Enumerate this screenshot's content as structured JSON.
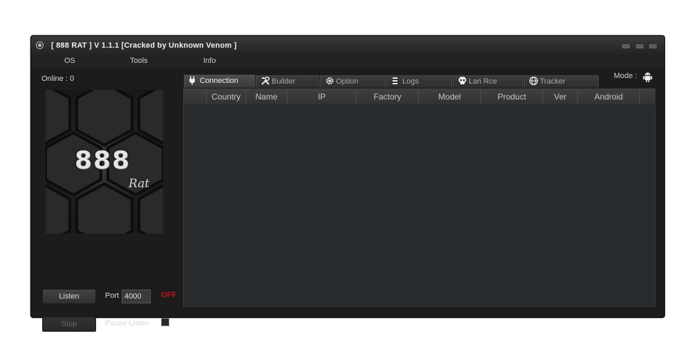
{
  "window": {
    "title": "[  888 RAT  ] V 1.1.1 [Cracked by Unknown Venom ]"
  },
  "menu": [
    "OS",
    "Tools",
    "Info"
  ],
  "status": {
    "online_label": "Online : 0"
  },
  "logo": {
    "main": "888",
    "sub": "Rat"
  },
  "controls": {
    "listen_label": "Listen",
    "stop_label": "Stop",
    "port_label": "Port",
    "port_value": "4000",
    "state_text": "OFF",
    "pause_label": "Pause Listen",
    "pause_checked": false
  },
  "tabs": [
    {
      "label": "Connection",
      "icon": "plug-icon",
      "active": true
    },
    {
      "label": "Builder",
      "icon": "tools-icon",
      "active": false
    },
    {
      "label": "Option",
      "icon": "gear-icon",
      "active": false
    },
    {
      "label": "Logs",
      "icon": "logs-icon",
      "active": false
    },
    {
      "label": "Lan Rce",
      "icon": "skull-icon",
      "active": false
    },
    {
      "label": "Tracker",
      "icon": "globe-icon",
      "active": false
    }
  ],
  "mode": {
    "label": "Mode :",
    "icon": "android-icon"
  },
  "table": {
    "columns": [
      "",
      "Country",
      "Name",
      "IP",
      "Factory",
      "Model",
      "Product",
      "Ver",
      "Android"
    ],
    "rows": []
  },
  "colors": {
    "off_state": "#c0161b",
    "window_bg": "#1c1c1c",
    "grid_bg": "#282b2d"
  }
}
